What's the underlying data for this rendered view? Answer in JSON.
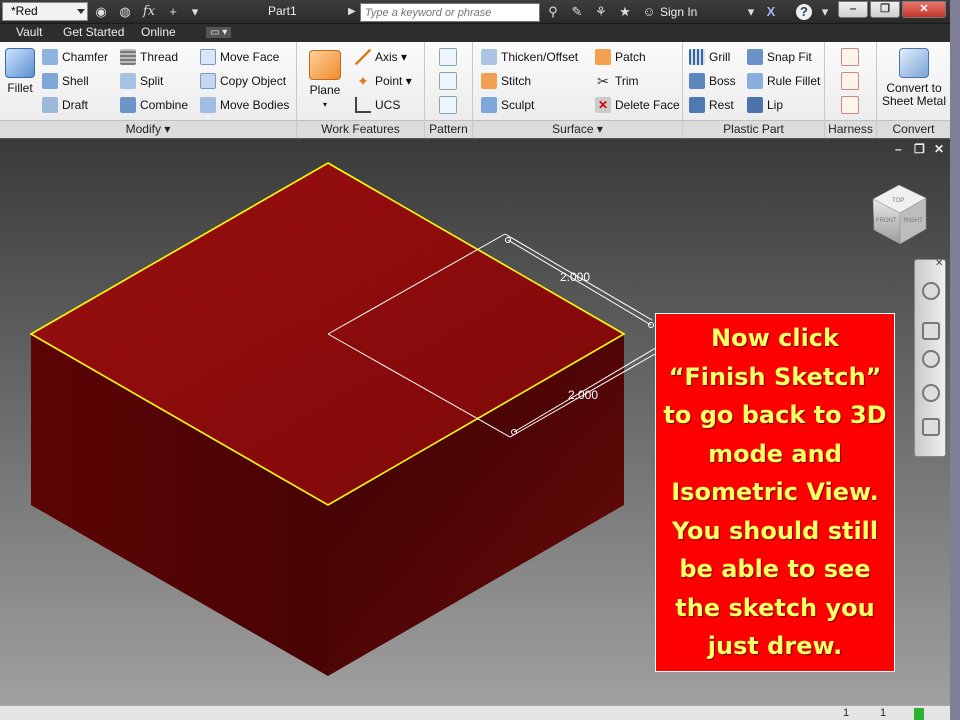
{
  "quick_access": {
    "material_value": "*Red",
    "document_title": "Part1",
    "search_placeholder": "Type a keyword or phrase",
    "sign_in_label": "Sign In",
    "fx_label": "fx"
  },
  "ribbon_tabs": [
    "Vault",
    "Get Started",
    "Online"
  ],
  "panels": {
    "modify": {
      "label": "Modify",
      "fillet": "Fillet",
      "chamfer": "Chamfer",
      "shell": "Shell",
      "draft": "Draft",
      "thread": "Thread",
      "split": "Split",
      "combine": "Combine",
      "move_face": "Move Face",
      "copy_object": "Copy Object",
      "move_bodies": "Move Bodies"
    },
    "work_features": {
      "label": "Work Features",
      "plane": "Plane",
      "axis": "Axis",
      "point": "Point",
      "ucs": "UCS"
    },
    "pattern": {
      "label": "Pattern"
    },
    "surface": {
      "label": "Surface",
      "thicken_offset": "Thicken/Offset",
      "stitch": "Stitch",
      "sculpt": "Sculpt",
      "patch": "Patch",
      "trim": "Trim",
      "delete_face": "Delete Face"
    },
    "plastic_part": {
      "label": "Plastic Part",
      "grill": "Grill",
      "boss": "Boss",
      "rest": "Rest",
      "snap_fit": "Snap Fit",
      "rule_fillet": "Rule Fillet",
      "lip": "Lip"
    },
    "harness": {
      "label": "Harness"
    },
    "convert": {
      "label": "Convert",
      "convert_to_sheet_metal_line1": "Convert to",
      "convert_to_sheet_metal_line2": "Sheet Metal"
    }
  },
  "viewport": {
    "dimensions": [
      "2.000",
      "2.000"
    ],
    "viewcube_faces": [
      "TOP",
      "FRONT",
      "RIGHT"
    ],
    "body_color": "#8b0b0b",
    "edge_color": "#ffff00"
  },
  "callout": {
    "lines": [
      "Now click",
      "“Finish Sketch”",
      "to go back to 3D",
      "mode and",
      "Isometric View.",
      "You should still",
      "be able to see",
      "the sketch you",
      "just drew."
    ],
    "background": "#ff0000",
    "text_color": "#ffff66"
  },
  "status_bar": {
    "values": [
      "1",
      "1"
    ]
  }
}
